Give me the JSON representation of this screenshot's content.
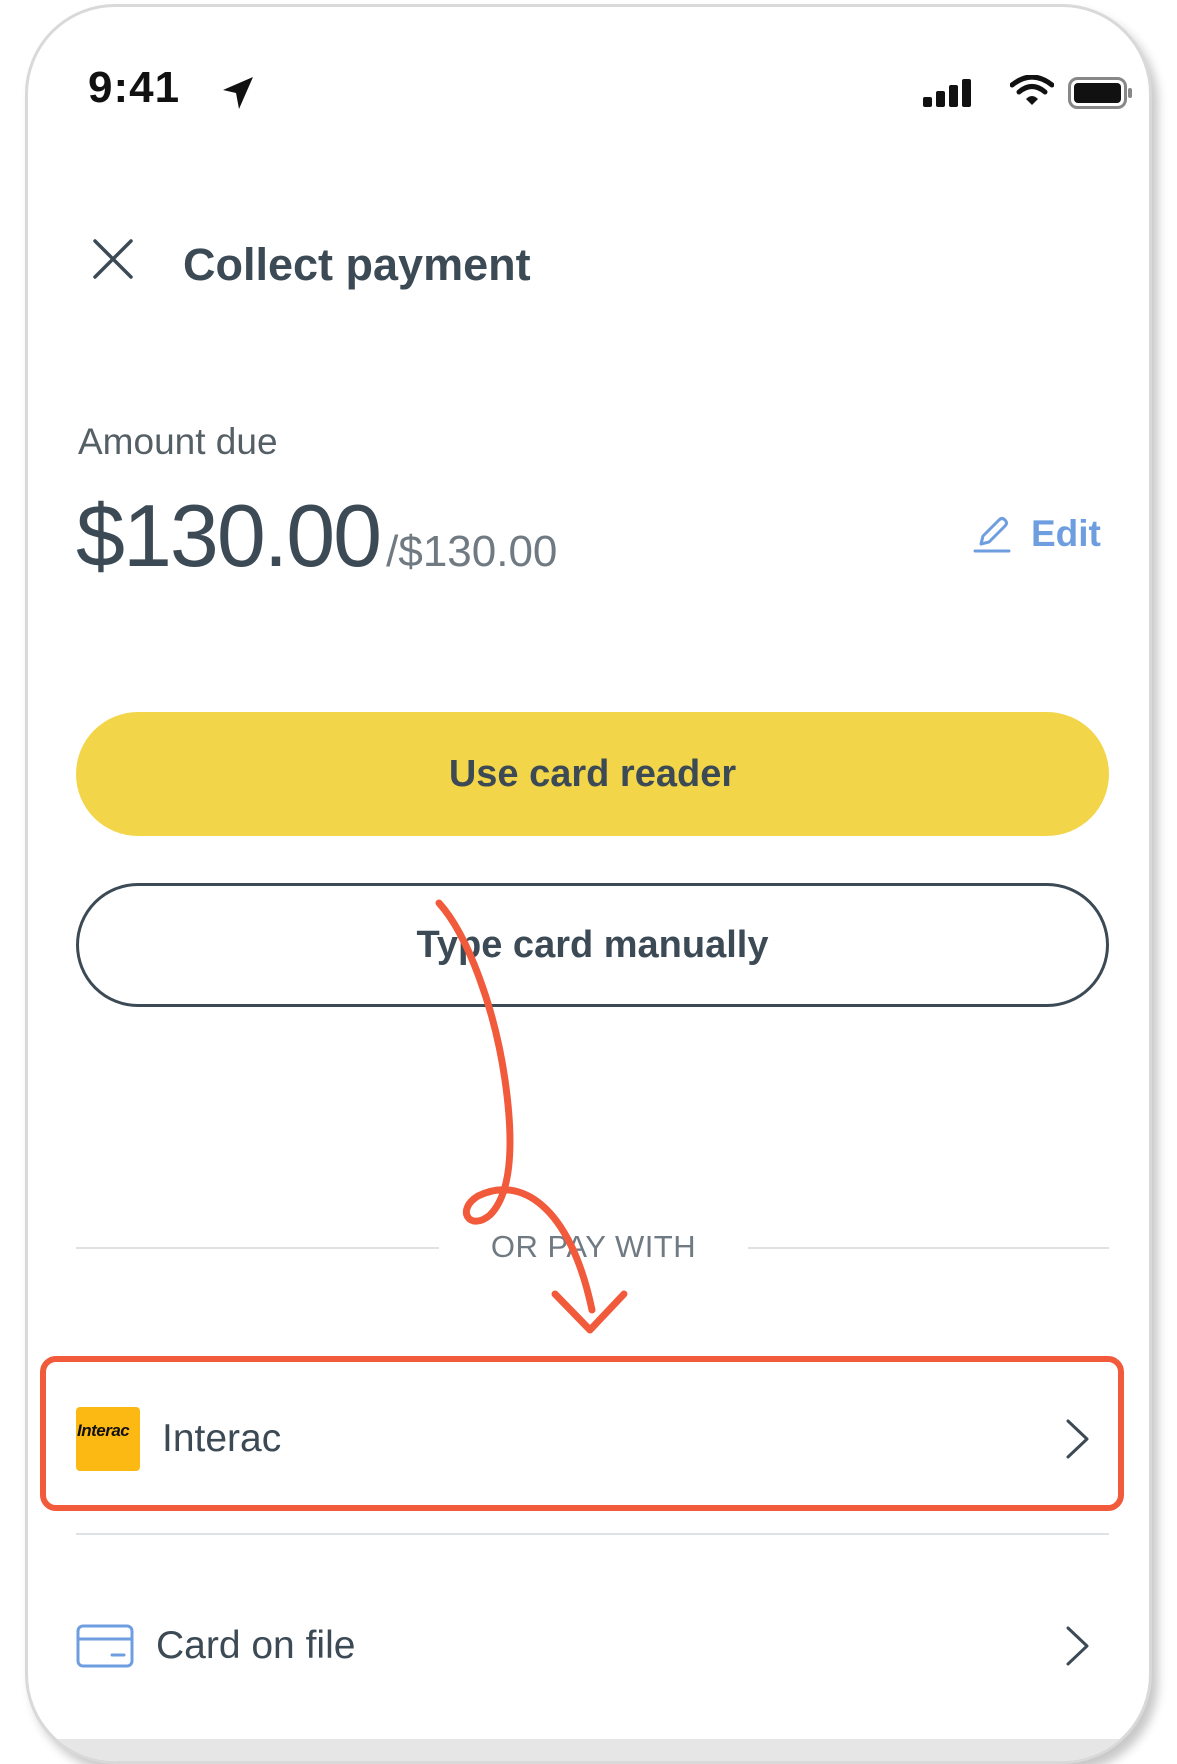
{
  "status_bar": {
    "time": "9:41"
  },
  "header": {
    "title": "Collect payment"
  },
  "amount": {
    "label": "Amount due",
    "value": "$130.00",
    "separator": "/",
    "total": "$130.00",
    "edit_label": "Edit"
  },
  "actions": {
    "card_reader_label": "Use card reader",
    "manual_label": "Type card manually"
  },
  "divider_text": "OR PAY WITH",
  "payment_options": [
    {
      "label": "Interac",
      "logo_text": "Interac",
      "icon": "interac-logo"
    },
    {
      "label": "Card on file",
      "icon": "credit-card-icon"
    }
  ],
  "colors": {
    "primary": "#f3d54a",
    "text": "#3c4a55",
    "link": "#6e9ee0",
    "annotation": "#f15a3a"
  }
}
